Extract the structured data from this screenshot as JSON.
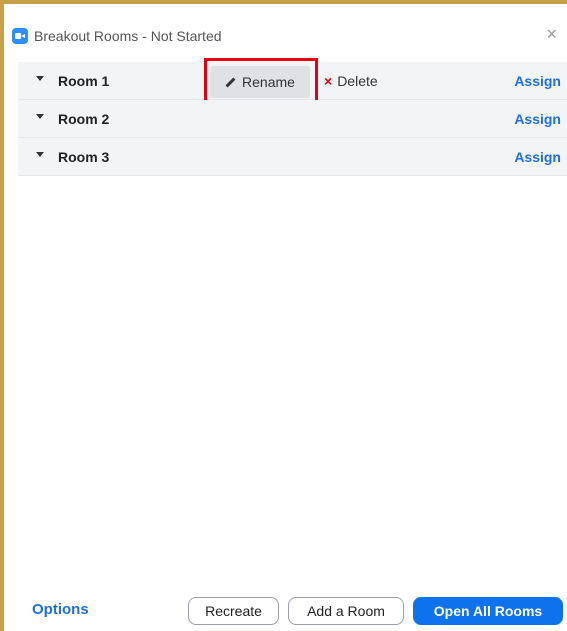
{
  "window": {
    "title": "Breakout Rooms - Not Started",
    "close_symbol": "×"
  },
  "rooms": [
    {
      "name": "Room 1",
      "assign_label": "Assign",
      "expanded_actions": true
    },
    {
      "name": "Room 2",
      "assign_label": "Assign"
    },
    {
      "name": "Room 3",
      "assign_label": "Assign"
    }
  ],
  "room_actions": {
    "rename_label": "Rename",
    "delete_label": "Delete",
    "delete_symbol": "×"
  },
  "footer": {
    "options_label": "Options",
    "recreate_label": "Recreate",
    "add_room_label": "Add a Room",
    "open_all_label": "Open All Rooms"
  },
  "colors": {
    "accent": "#0e72ed",
    "link": "#1f6fde",
    "highlight": "#e4000f",
    "row_background": "#f3f4f6"
  },
  "icons": {
    "app": "zoom-camera-icon",
    "close": "close-icon",
    "caret": "caret-down-icon",
    "rename": "pencil-icon",
    "delete": "x-icon"
  }
}
